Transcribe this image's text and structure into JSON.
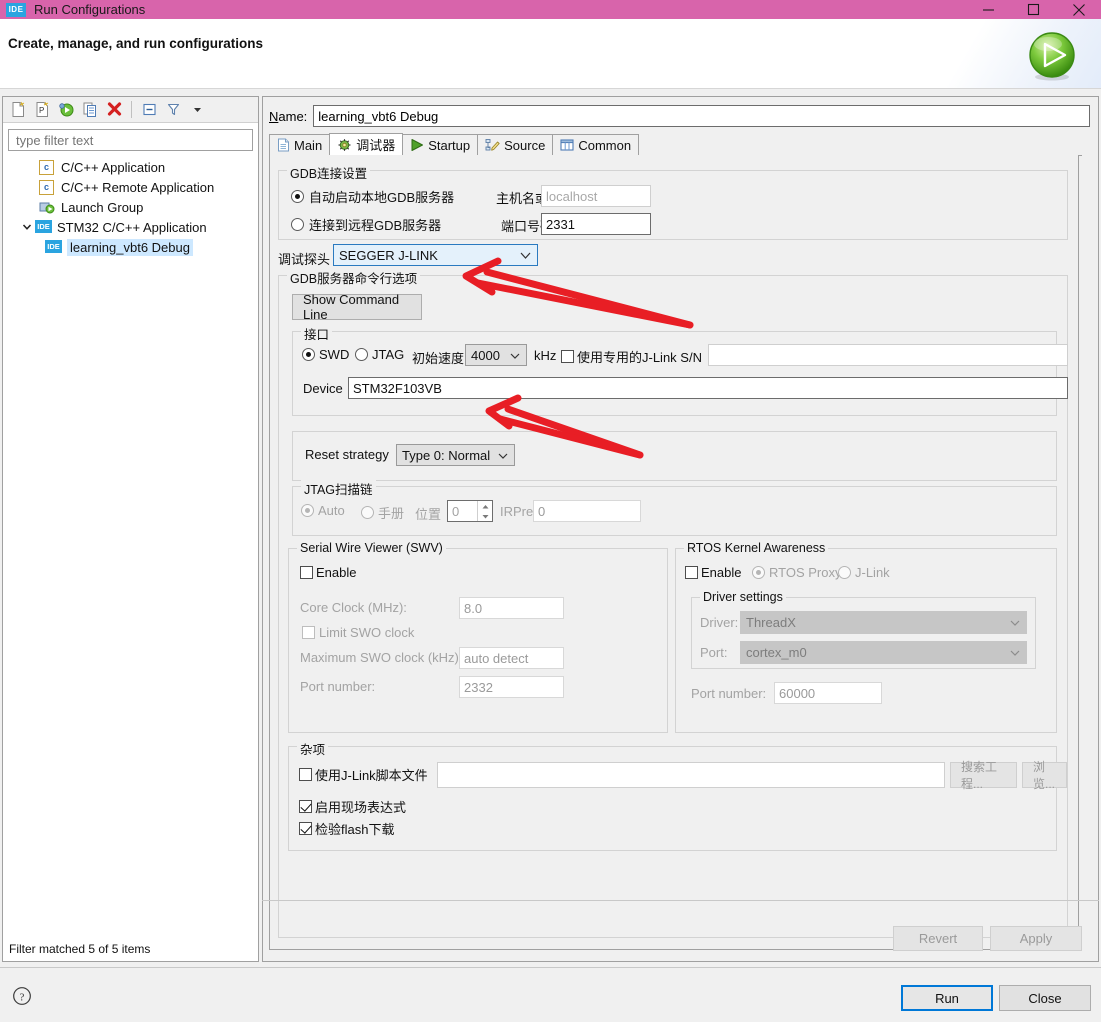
{
  "window": {
    "title": "Run Configurations",
    "app_icon": "IDE",
    "titlebar_color": "#d864ab",
    "minimize": "minimize-icon",
    "maximize": "maximize-icon",
    "close": "close-icon"
  },
  "header": {
    "title": "Create, manage, and run configurations",
    "badge_icon": "run-play-icon"
  },
  "sidebar": {
    "toolbar": [
      {
        "name": "new-configuration-icon",
        "tooltip": "New launch configuration"
      },
      {
        "name": "new-prototype-icon",
        "tooltip": "New prototype"
      },
      {
        "name": "new-launch-group-icon",
        "tooltip": "New launch group"
      },
      {
        "name": "duplicate-icon",
        "tooltip": "Duplicate"
      },
      {
        "name": "delete-icon",
        "tooltip": "Delete"
      },
      {
        "name": "collapse-all-icon",
        "tooltip": "Collapse All"
      },
      {
        "name": "filter-icon",
        "tooltip": "Filter"
      },
      {
        "name": "view-menu-icon",
        "tooltip": "View Menu"
      }
    ],
    "filter_placeholder": "type filter text",
    "filter_value": "",
    "tree": [
      {
        "label": "C/C++ Application",
        "icon": "c-app-icon",
        "indent": 1,
        "expander": "",
        "selected": false
      },
      {
        "label": "C/C++ Remote Application",
        "icon": "c-app-icon",
        "indent": 1,
        "expander": "",
        "selected": false
      },
      {
        "label": "Launch Group",
        "icon": "launch-group-icon",
        "indent": 1,
        "expander": "",
        "selected": false
      },
      {
        "label": "STM32 C/C++ Application",
        "icon": "ide-icon",
        "indent": 0,
        "expander": "expanded",
        "selected": false
      },
      {
        "label": "learning_vbt6 Debug",
        "icon": "ide-icon",
        "indent": 2,
        "expander": "",
        "selected": true
      }
    ],
    "status": "Filter matched 5 of 5 items"
  },
  "form": {
    "name_label": "Name:",
    "name_value": "learning_vbt6 Debug",
    "tabs": [
      {
        "label": "Main",
        "icon": "document-icon",
        "active": false
      },
      {
        "label": "调试器",
        "icon": "debugger-bug-icon",
        "active": true
      },
      {
        "label": "Startup",
        "icon": "play-green-icon",
        "active": false
      },
      {
        "label": "Source",
        "icon": "source-pencil-icon",
        "active": false
      },
      {
        "label": "Common",
        "icon": "common-table-icon",
        "active": false
      }
    ],
    "gdb_connection": {
      "title": "GDB连接设置",
      "auto_start_label": "自动启动本地GDB服务器",
      "auto_start_selected": true,
      "host_label": "主机名或IP地址",
      "host_placeholder": "localhost",
      "host_value": "",
      "remote_label": "连接到远程GDB服务器",
      "remote_selected": false,
      "port_label": "端口号码",
      "port_value": "2331"
    },
    "probe": {
      "label": "调试探头",
      "value": "SEGGER J-LINK",
      "highlighted": true
    },
    "gdb_server_options": {
      "title": "GDB服务器命令行选项",
      "show_command_line_button": "Show Command Line",
      "interface": {
        "title": "接口",
        "swd_label": "SWD",
        "swd_selected": true,
        "jtag_label": "JTAG",
        "jtag_selected": false,
        "speed_label": "初始速度",
        "speed_value": "4000",
        "speed_unit": "kHz",
        "serial_checkbox_label": "使用专用的J-Link S/N",
        "serial_checked": false,
        "serial_value": "",
        "device_label": "Device",
        "device_value": "STM32F103VB"
      },
      "reset": {
        "label": "Reset strategy",
        "value": "Type 0: Normal"
      },
      "jtag_scan_chain": {
        "title": "JTAG扫描链",
        "auto_label": "Auto",
        "auto_selected": true,
        "manual_label": "手册",
        "manual_selected": false,
        "position_label": "位置",
        "position_value": "0",
        "irpre_label": "IRPre",
        "irpre_value": "0",
        "disabled": true
      },
      "swv": {
        "title": "Serial Wire Viewer (SWV)",
        "enable_label": "Enable",
        "enable_checked": false,
        "core_clock_label": "Core Clock (MHz):",
        "core_clock_value": "8.0",
        "limit_swo_label": "Limit SWO clock",
        "limit_swo_checked": false,
        "max_swo_label": "Maximum SWO clock (kHz):",
        "max_swo_value": "auto detect",
        "port_label": "Port number:",
        "port_value": "2332"
      },
      "rtos": {
        "title": "RTOS Kernel Awareness",
        "enable_label": "Enable",
        "enable_checked": false,
        "proxy_label": "RTOS Proxy",
        "proxy_selected": true,
        "jlink_label": "J-Link",
        "jlink_selected": false,
        "driver_settings_title": "Driver settings",
        "driver_label": "Driver:",
        "driver_value": "ThreadX",
        "port_label": "Port:",
        "port_value": "cortex_m0",
        "port_number_label": "Port number:",
        "port_number_value": "60000"
      },
      "misc": {
        "title": "杂项",
        "script_checkbox_label": "使用J-Link脚本文件",
        "script_checked": false,
        "script_value": "",
        "search_project_button": "搜索工程...",
        "browse_button": "浏览...",
        "live_expr_label": "启用现场表达式",
        "live_expr_checked": true,
        "verify_flash_label": "检验flash下载",
        "verify_flash_checked": true
      }
    }
  },
  "footer": {
    "revert_button": "Revert",
    "apply_button": "Apply",
    "help_icon": "help-question-icon",
    "run_button": "Run",
    "close_button": "Close"
  },
  "annotations": {
    "color": "#e81e25",
    "arrows": [
      {
        "name": "arrow-to-debug-probe",
        "target": "调试探头 combo"
      },
      {
        "name": "arrow-to-device-field",
        "target": "Device field"
      }
    ]
  }
}
